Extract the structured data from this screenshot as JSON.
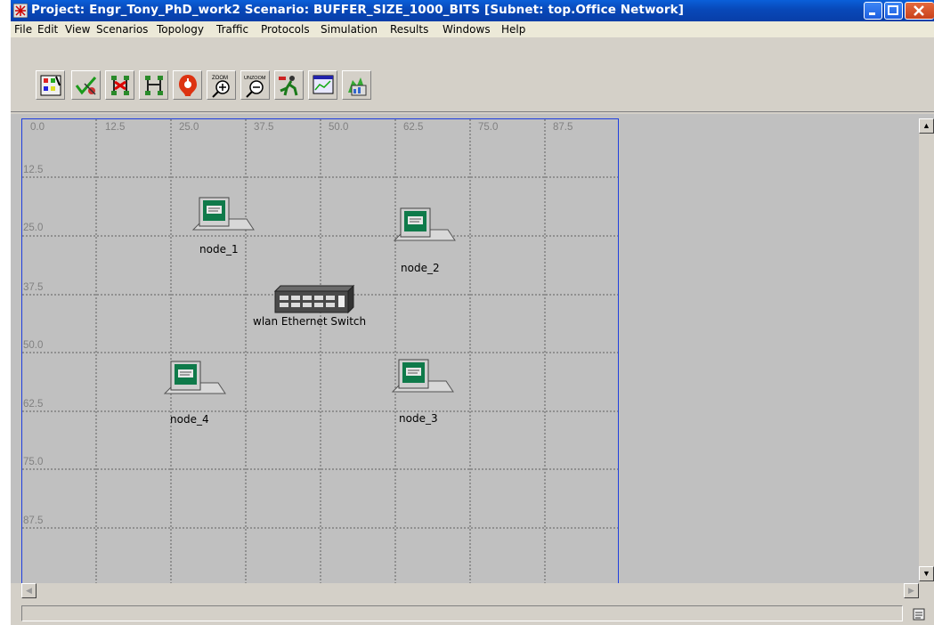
{
  "window": {
    "title": "Project: Engr_Tony_PhD_work2 Scenario: BUFFER_SIZE_1000_BITS  [Subnet: top.Office Network]"
  },
  "menu": [
    "File",
    "Edit",
    "View",
    "Scenarios",
    "Topology",
    "Traffic",
    "Protocols",
    "Simulation",
    "Results",
    "Windows",
    "Help"
  ],
  "toolbar": {
    "tools": [
      "open-object-palette",
      "verify-links",
      "fail-links",
      "recover-links",
      "return-to-parent-subnet",
      "zoom",
      "unzoom",
      "configure-run-simulation",
      "view-results",
      "hide-show-graphs"
    ],
    "zoom_label": "ZOOM",
    "unzoom_label": "UNZOOM"
  },
  "grid": {
    "x_labels": [
      "0.0",
      "12.5",
      "25.0",
      "37.5",
      "50.0",
      "62.5",
      "75.0",
      "87.5"
    ],
    "y_labels": [
      "12.5",
      "25.0",
      "37.5",
      "50.0",
      "62.5",
      "75.0",
      "87.5"
    ]
  },
  "nodes": {
    "node_1": "node_1",
    "node_2": "node_2",
    "node_3": "node_3",
    "node_4": "node_4",
    "switch": "wlan Ethernet Switch"
  },
  "colors": {
    "titlebar": "#0a5fd9",
    "workspace": "#c0c0c0",
    "workspace_border": "#1f3fdf",
    "grid_line": "#606060"
  }
}
